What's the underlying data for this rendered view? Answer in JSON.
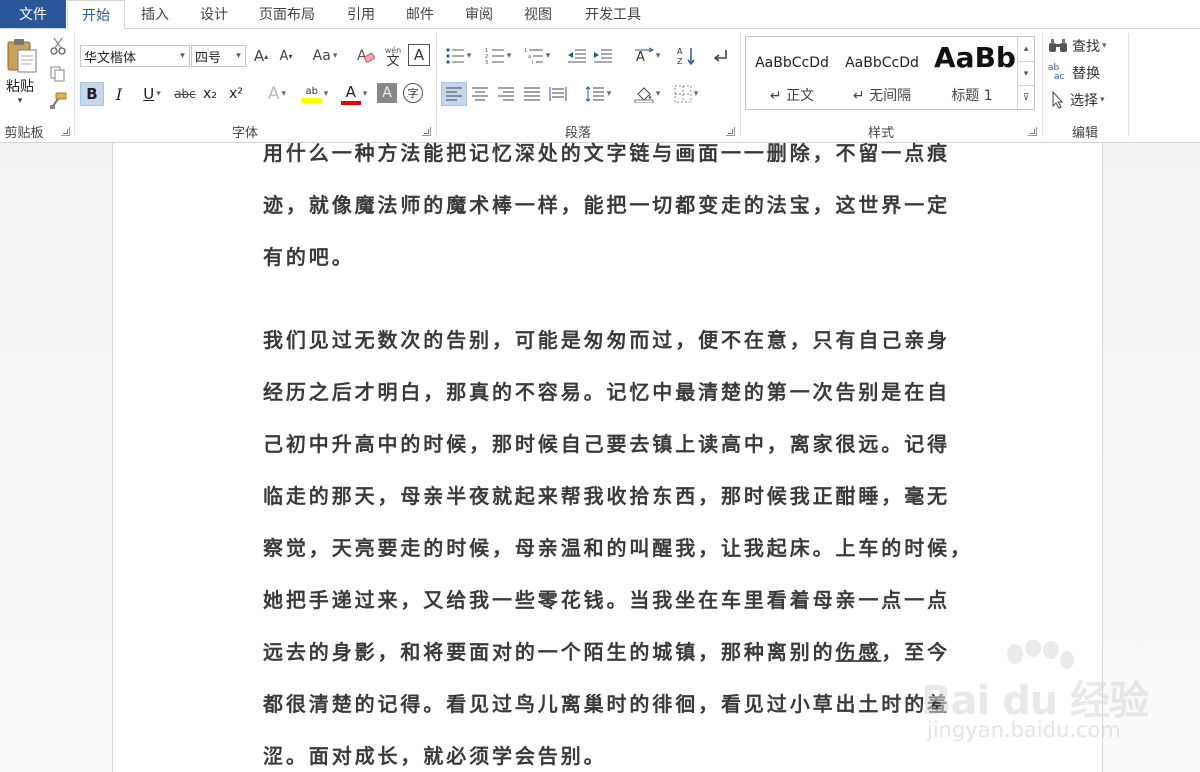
{
  "tabs": {
    "file": "文件",
    "items": [
      "开始",
      "插入",
      "设计",
      "页面布局",
      "引用",
      "邮件",
      "审阅",
      "视图",
      "开发工具"
    ],
    "active": "开始"
  },
  "clipboard": {
    "paste_label": "粘贴",
    "group_label": "剪贴板"
  },
  "font": {
    "family": "华文楷体",
    "size": "四号",
    "grow_glyph": "A",
    "shrink_glyph": "A",
    "case_label": "Aa",
    "phonetic_top": "wén",
    "phonetic_bottom": "文",
    "border_char": "A",
    "bold": "B",
    "italic": "I",
    "underline": "U",
    "strike": "abc",
    "subscript": "x₂",
    "superscript": "x²",
    "effects": "A",
    "highlight_text": "ab",
    "font_color_char": "A",
    "shading_char": "A",
    "enclose_char": "字",
    "group_label": "字体",
    "highlight_color": "#ffff00",
    "font_color": "#e00000"
  },
  "paragraph": {
    "group_label": "段落"
  },
  "styles": {
    "items": [
      {
        "sample": "AaBbCcDd",
        "name": "↵ 正文"
      },
      {
        "sample": "AaBbCcDd",
        "name": "↵ 无间隔"
      },
      {
        "sample": "AaBb",
        "name": "标题 1"
      }
    ],
    "group_label": "样式"
  },
  "editing": {
    "find": "查找",
    "replace": "替换",
    "select": "选择",
    "replace_icon_top": "ab",
    "replace_icon_bottom": "ac",
    "group_label": "编辑"
  },
  "document": {
    "paragraph1": [
      "用什么一种方法能把记忆深处的文字链与画面一一删除，不留一点痕",
      "迹，就像魔法师的魔术棒一样，能把一切都变走的法宝，这世界一定",
      "有的吧。"
    ],
    "paragraph2": [
      "我们见过无数次的告别，可能是匆匆而过，便不在意，只有自己亲身",
      "经历之后才明白，那真的不容易。记忆中最清楚的第一次告别是在自",
      "己初中升高中的时候，那时候自己要去镇上读高中，离家很远。记得",
      "临走的那天，母亲半夜就起来帮我收拾东西，那时候我正酣睡，毫无",
      "察觉，天亮要走的时候，母亲温和的叫醒我，让我起床。上车的时候，",
      "她把手递过来，又给我一些零花钱。当我坐在车里看着母亲一点一点"
    ],
    "line_underline": {
      "before": "远去的身影，和将要面对的一个陌生的城镇，那种离别的",
      "underlined": "伤感",
      "after": "，至今"
    },
    "paragraph2_end": [
      "都很清楚的记得。看见过鸟儿离巢时的徘徊，看见过小草出土时的羞",
      "涩。面对成长，就必须学会告别。"
    ]
  },
  "watermark": {
    "brand": "Bai du 经验",
    "site": "jingyan.baidu.com"
  }
}
